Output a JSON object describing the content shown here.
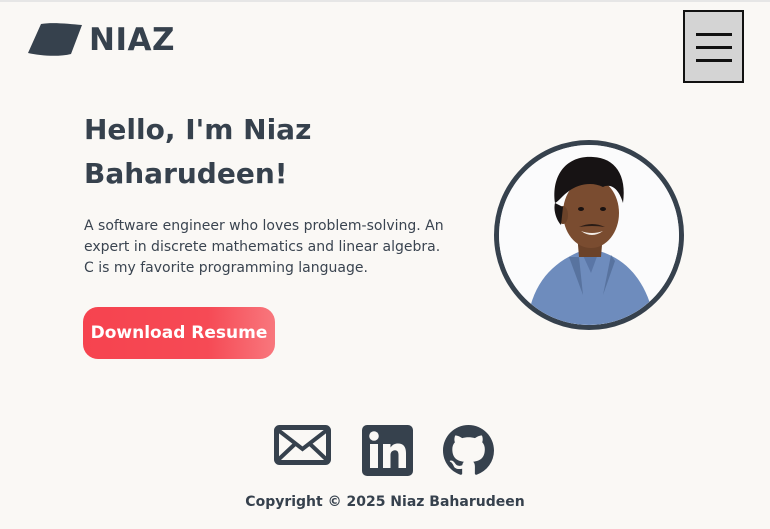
{
  "header": {
    "logo_text": "NIAZ",
    "logo_icon": "parallelogram-logo",
    "menu_icon": "hamburger-icon"
  },
  "hero": {
    "title": "Hello, I'm Niaz Baharudeen!",
    "description": "A software engineer who loves problem-solving. An expert in discrete mathematics and linear algebra. C is my favorite programming language.",
    "download_label": "Download Resume",
    "avatar_alt": "Niaz Baharudeen"
  },
  "social": [
    {
      "name": "email",
      "icon": "envelope-icon"
    },
    {
      "name": "linkedin",
      "icon": "linkedin-icon"
    },
    {
      "name": "github",
      "icon": "github-icon"
    }
  ],
  "footer": {
    "copyright": "Copyright © 2025 Niaz Baharudeen"
  },
  "colors": {
    "background": "#faf8f5",
    "text": "#36414d",
    "accent": "#f6434f",
    "menu_background": "#d4d4d4"
  }
}
